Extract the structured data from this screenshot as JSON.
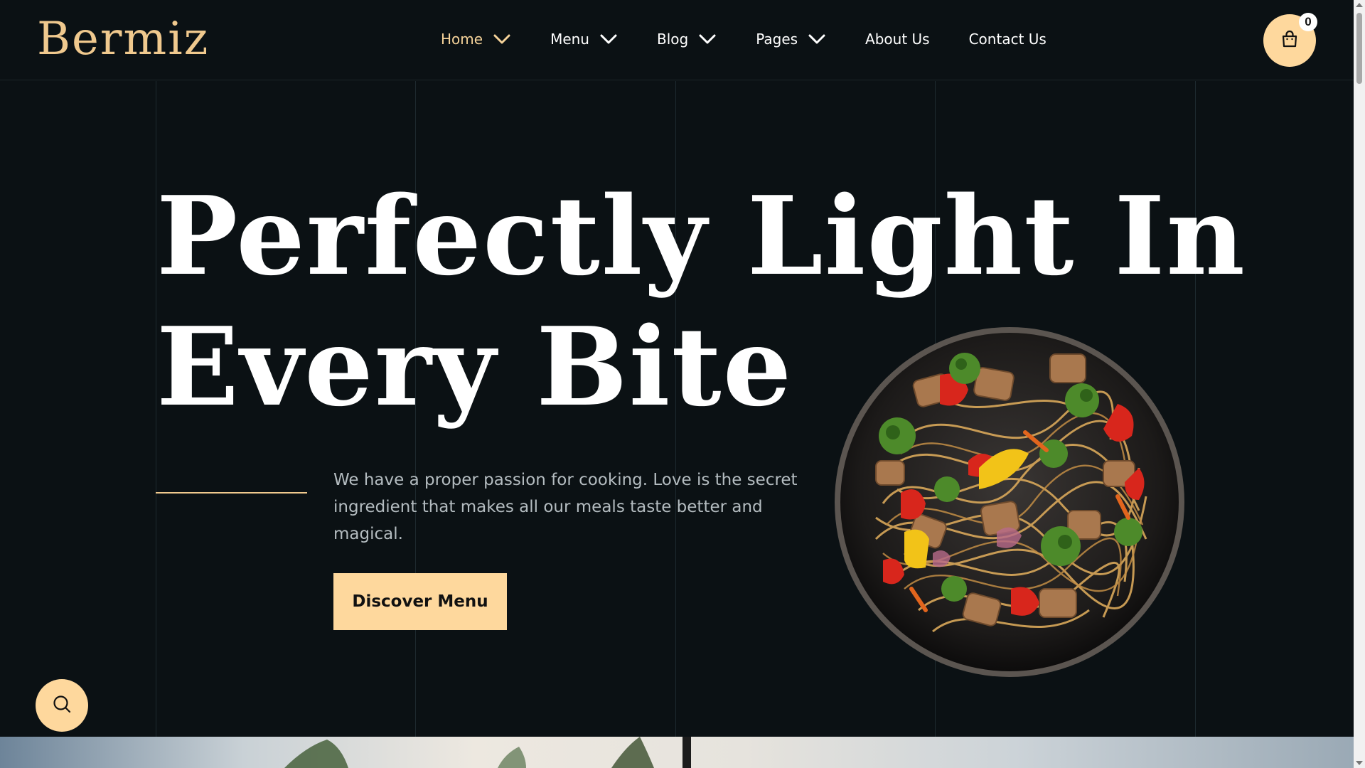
{
  "brand": {
    "logo_text": "Bermiz",
    "accent_color": "#fed89d",
    "background_color": "#0b1114"
  },
  "nav": {
    "items": [
      {
        "label": "Home",
        "has_dropdown": true,
        "active": true
      },
      {
        "label": "Menu",
        "has_dropdown": true,
        "active": false
      },
      {
        "label": "Blog",
        "has_dropdown": true,
        "active": false
      },
      {
        "label": "Pages",
        "has_dropdown": true,
        "active": false
      },
      {
        "label": "About Us",
        "has_dropdown": false,
        "active": false
      },
      {
        "label": "Contact Us",
        "has_dropdown": false,
        "active": false
      }
    ]
  },
  "cart": {
    "icon": "shopping-bag-icon",
    "count": "0"
  },
  "hero": {
    "title_line1": "Perfectly Light In",
    "title_line2": "Every Bite",
    "description_line1": "We have a proper passion for cooking. Love is the secret",
    "description_line2": "ingredient that makes all our meals taste better and magical.",
    "cta_label": "Discover Menu",
    "image": "noodle-stir-fry-bowl"
  },
  "search": {
    "icon": "search-icon"
  }
}
